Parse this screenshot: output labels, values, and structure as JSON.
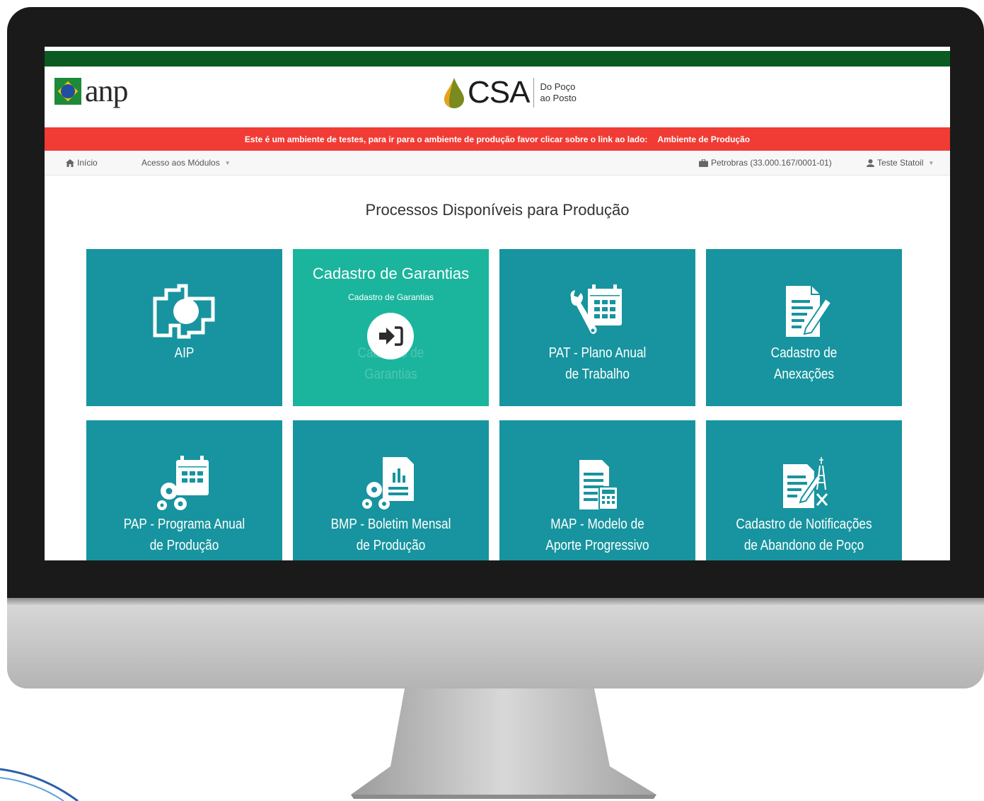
{
  "header": {
    "anp_logo_text": "anp",
    "csa_logo_text": "CSA",
    "csa_tagline_line1": "Do Poço",
    "csa_tagline_line2": "ao Posto"
  },
  "banner": {
    "message": "Este é um ambiente de testes, para ir para o ambiente de produção favor clicar sobre o link ao lado:",
    "link_label": "Ambiente de Produção",
    "color": "#f03c34"
  },
  "navbar": {
    "home_label": "Início",
    "modules_label": "Acesso aos Módulos",
    "company_label": "Petrobras (33.000.167/0001-01)",
    "user_label": "Teste Statoil"
  },
  "main": {
    "title": "Processos Disponíveis para Produção",
    "tiles": [
      {
        "icon": "puzzle-icon",
        "label_line1": "AIP",
        "label_line2": ""
      },
      {
        "icon": "enter-icon",
        "hover_title": "Cadastro de Garantias",
        "hover_subtitle": "Cadastro de Garantias",
        "label_line1": "Cadastro de",
        "label_line2": "Garantias"
      },
      {
        "icon": "calendar-wrench-icon",
        "label_line1": "PAT - Plano Anual",
        "label_line2": "de Trabalho"
      },
      {
        "icon": "document-edit-icon",
        "label_line1": "Cadastro de",
        "label_line2": "Anexações"
      },
      {
        "icon": "calendar-gears-icon",
        "label_line1": "PAP - Programa Anual",
        "label_line2": "de Produção"
      },
      {
        "icon": "report-gears-icon",
        "label_line1": "BMP - Boletim Mensal",
        "label_line2": "de Produção"
      },
      {
        "icon": "document-calculator-icon",
        "label_line1": "MAP - Modelo de",
        "label_line2": "Aporte Progressivo"
      },
      {
        "icon": "document-abandon-icon",
        "label_line1": "Cadastro de Notificações",
        "label_line2": "de Abandono de Poço"
      }
    ]
  },
  "colors": {
    "tile": "#17949f",
    "tile_hover": "#1bb59d",
    "top_bar": "#0b5a22"
  }
}
